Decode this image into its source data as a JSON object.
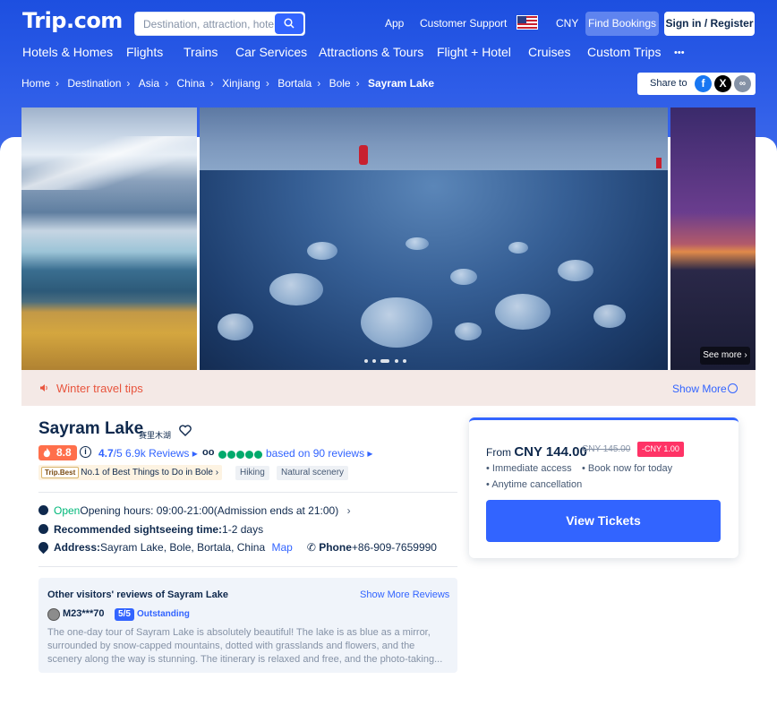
{
  "header": {
    "logo": "Trip.com",
    "search_placeholder": "Destination, attraction, hotel.",
    "app": "App",
    "support": "Customer Support",
    "currency": "CNY",
    "find_bookings": "Find Bookings",
    "sign_in": "Sign in / Register"
  },
  "nav": [
    "Hotels & Homes",
    "Flights",
    "Trains",
    "Car Services",
    "Attractions & Tours",
    "Flight + Hotel",
    "Cruises",
    "Custom Trips",
    "•••"
  ],
  "breadcrumb": [
    "Home",
    "Destination",
    "Asia",
    "China",
    "Xinjiang",
    "Bortala",
    "Bole",
    "Sayram Lake"
  ],
  "share": {
    "label": "Share to",
    "icons": [
      "facebook-icon",
      "x-icon",
      "link-icon"
    ]
  },
  "gallery": {
    "see_more": "See more"
  },
  "tips": {
    "text": "Winter travel tips",
    "show_more": "Show More"
  },
  "attraction": {
    "name": "Sayram Lake",
    "name_cn": "赛里木湖",
    "score": "8.8",
    "rating": "4.7",
    "rating_suffix": "/5",
    "reviews": "6.9k Reviews",
    "ta_text": "based on 90 reviews",
    "best_logo": "Trip.Best",
    "best_text": "No.1 of Best Things to Do in Bole",
    "tags": [
      "Hiking",
      "Natural scenery"
    ],
    "open_label": "Open",
    "hours": "Opening hours: 09:00-21:00(Admission ends at 21:00)",
    "sightseeing_label": "Recommended sightseeing time:",
    "sightseeing_value": "1-2 days",
    "address_label": "Address:",
    "address_value": "Sayram Lake, Bole, Bortala, China",
    "map": "Map",
    "phone_label": "Phone",
    "phone_value": "+86-909-7659990"
  },
  "reviews": {
    "title": "Other visitors' reviews of Sayram Lake",
    "show_more": "Show More Reviews",
    "user": "M23***70",
    "score": "5/5",
    "score_label": "Outstanding",
    "body": "The one-day tour of Sayram Lake is absolutely beautiful! The lake is as blue as a mirror, surrounded by snow-capped mountains, dotted with grasslands and flowers, and the scenery along the way is stunning. The itinerary is relaxed and free, and the photo-taking..."
  },
  "price": {
    "from": "From",
    "price": "CNY 144.00",
    "old_price": "CNY 145.00",
    "discount": "-CNY 1.00",
    "features": [
      "Immediate access",
      "Book now for today",
      "Anytime cancellation"
    ],
    "button": "View Tickets"
  },
  "colors": {
    "brand": "#3264ff",
    "header_bg": "#2450e0",
    "score": "#ff6f4b",
    "discount": "#ff3366",
    "tips": "#e8553e"
  }
}
